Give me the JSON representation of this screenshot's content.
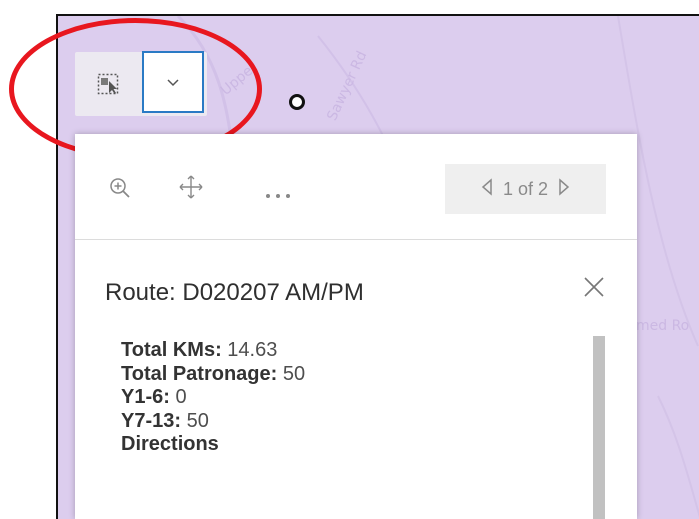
{
  "map": {
    "road_labels": [
      "Upper",
      "Sawyer Rd",
      "med Ro"
    ]
  },
  "toolbar": {
    "select_icon": "selection-icon",
    "dropdown_icon": "chevron-down-icon"
  },
  "popup": {
    "actions": [
      {
        "icon": "zoom-to-icon"
      },
      {
        "icon": "move-icon"
      },
      {
        "icon": "more-icon"
      }
    ],
    "pager": {
      "text": "1 of 2"
    },
    "title": "Route: D020207 AM/PM",
    "fields": [
      {
        "label": "Total KMs:",
        "value": "14.63"
      },
      {
        "label": "Total Patronage:",
        "value": "50"
      },
      {
        "label": "Y1-6:",
        "value": "0"
      },
      {
        "label": "Y7-13:",
        "value": "50"
      },
      {
        "label": "Directions",
        "value": ""
      }
    ]
  },
  "colors": {
    "map_bg": "#dccdee",
    "highlight": "#e8171f",
    "accent": "#2a7ac5"
  }
}
